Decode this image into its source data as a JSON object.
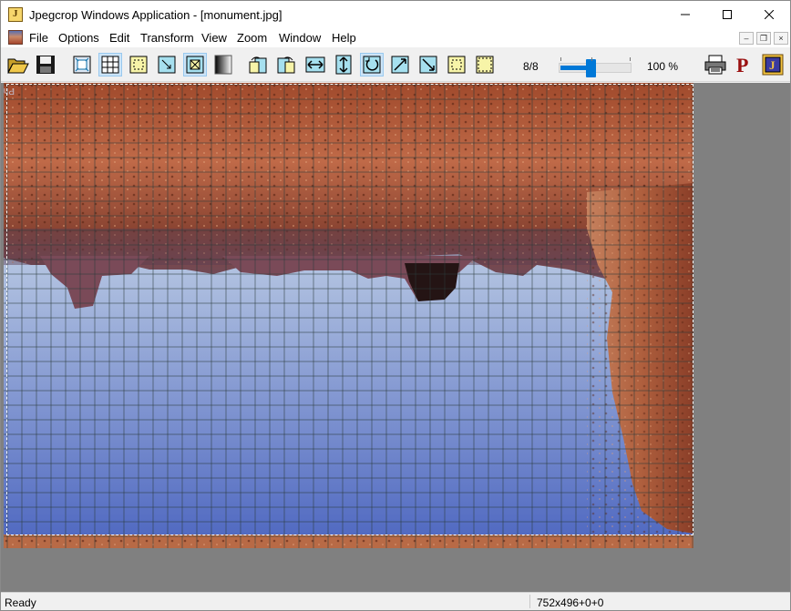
{
  "window": {
    "title": "Jpegcrop Windows Application - [monument.jpg]",
    "app_icon": "jpegcrop-app-icon",
    "controls": [
      "minimize-icon",
      "maximize-icon",
      "close-icon"
    ]
  },
  "menubar": {
    "items": [
      "File",
      "Options",
      "Edit",
      "Transform",
      "View",
      "Zoom",
      "Window",
      "Help"
    ],
    "doc_icon": "document-image-icon",
    "mdi_controls": [
      "mdi-minimize-icon",
      "mdi-restore-icon",
      "mdi-close-icon"
    ]
  },
  "toolbar": {
    "buttons": [
      {
        "name": "open",
        "icon": "folder-open-icon",
        "pressed": false
      },
      {
        "name": "save",
        "icon": "floppy-disk-icon",
        "pressed": false
      },
      {
        "name": "fit-window",
        "icon": "fit-window-icon",
        "pressed": false
      },
      {
        "name": "grid",
        "icon": "grid-icon",
        "pressed": true
      },
      {
        "name": "select-crop",
        "icon": "crop-select-icon",
        "pressed": false
      },
      {
        "name": "resize-crop",
        "icon": "crop-resize-icon",
        "pressed": false
      },
      {
        "name": "auto-crop",
        "icon": "auto-crop-icon",
        "pressed": true
      },
      {
        "name": "grayscale",
        "icon": "grayscale-icon",
        "pressed": false
      },
      {
        "name": "rotate-90-left",
        "icon": "rotate-left-icon",
        "pressed": false
      },
      {
        "name": "rotate-90-right",
        "icon": "rotate-right-icon",
        "pressed": false
      },
      {
        "name": "flip-horizontal",
        "icon": "flip-horizontal-icon",
        "pressed": false
      },
      {
        "name": "flip-vertical",
        "icon": "flip-vertical-icon",
        "pressed": false
      },
      {
        "name": "rotate-180",
        "icon": "rotate-180-icon",
        "pressed": true
      },
      {
        "name": "transpose",
        "icon": "transpose-icon",
        "pressed": false
      },
      {
        "name": "transverse",
        "icon": "transverse-icon",
        "pressed": false
      },
      {
        "name": "crop-trim",
        "icon": "crop-trim-icon",
        "pressed": false
      },
      {
        "name": "crop-extend",
        "icon": "crop-extend-icon",
        "pressed": false
      }
    ],
    "zoom_level": "8/8",
    "zoom_slider_fraction": 0.44,
    "zoom_percent": "100 %",
    "right_buttons": [
      "printer-icon",
      "p-letter-icon",
      "jpeg-info-icon"
    ]
  },
  "image": {
    "description_icon": "image-canvas",
    "grid_on": true
  },
  "statusbar": {
    "status": "Ready",
    "geometry": "752x496+0+0"
  },
  "colors": {
    "accent": "#0078d7",
    "pressed_bg": "#cce4f7",
    "client_bg": "#808080",
    "sky_top": "#e8eef4",
    "sky_bottom": "#5a72c2",
    "rock_dark": "#7a3a26",
    "rock_light": "#c9714a"
  }
}
